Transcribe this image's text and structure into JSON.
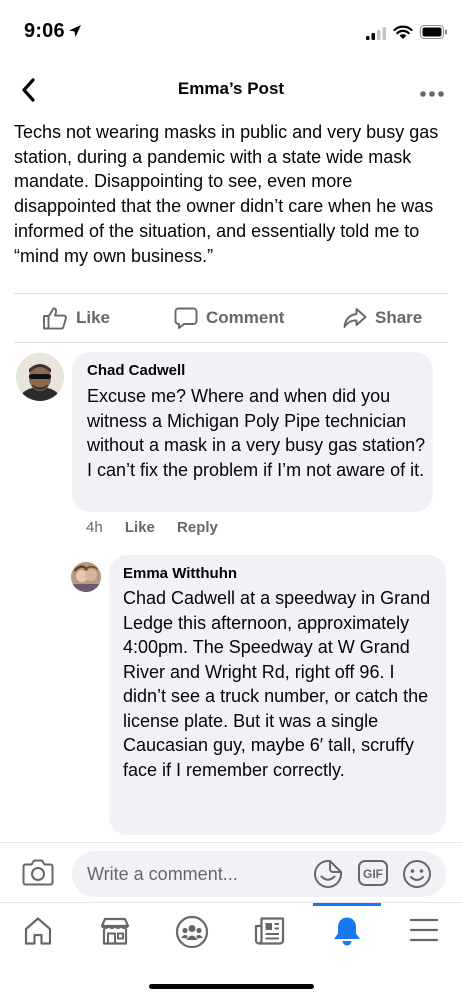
{
  "status_bar": {
    "time": "9:06"
  },
  "nav": {
    "title": "Emma’s Post"
  },
  "post": {
    "text": "Techs not wearing masks in public and very busy gas station, during a pandemic with a state wide mask mandate. Disappointing to see, even more disappointed that the owner didn’t care when he was informed of the situation, and essentially told me to “mind my own business.”"
  },
  "actions": {
    "like": "Like",
    "comment": "Comment",
    "share": "Share"
  },
  "comments": [
    {
      "author": "Chad Cadwell",
      "text": "Excuse me? Where and when did you witness a Michigan Poly Pipe technician without a mask in a very busy gas station? I can’t fix the problem if I’m not aware of it.",
      "time": "4h",
      "like_label": "Like",
      "reply_label": "Reply"
    },
    {
      "author": "Emma Witthuhn",
      "text": "Chad Cadwell at a speedway in Grand Ledge this afternoon, approximately 4:00pm. The Speedway at W Grand River and Wright Rd, right off 96. I didn’t see a truck number, or catch the license plate. But it was a single Caucasian guy, maybe 6′ tall, scruffy face if I remember correctly."
    }
  ],
  "composer": {
    "placeholder": "Write a comment...",
    "gif_label": "GIF"
  },
  "tabs": [
    {
      "icon": "home-icon",
      "active": false
    },
    {
      "icon": "marketplace-icon",
      "active": false
    },
    {
      "icon": "groups-icon",
      "active": false
    },
    {
      "icon": "news-icon",
      "active": false
    },
    {
      "icon": "bell-icon",
      "active": true
    },
    {
      "icon": "menu-icon",
      "active": false
    }
  ],
  "colors": {
    "accent": "#1877f2",
    "secondary_text": "#65676b",
    "bubble": "#f0f2f5"
  }
}
